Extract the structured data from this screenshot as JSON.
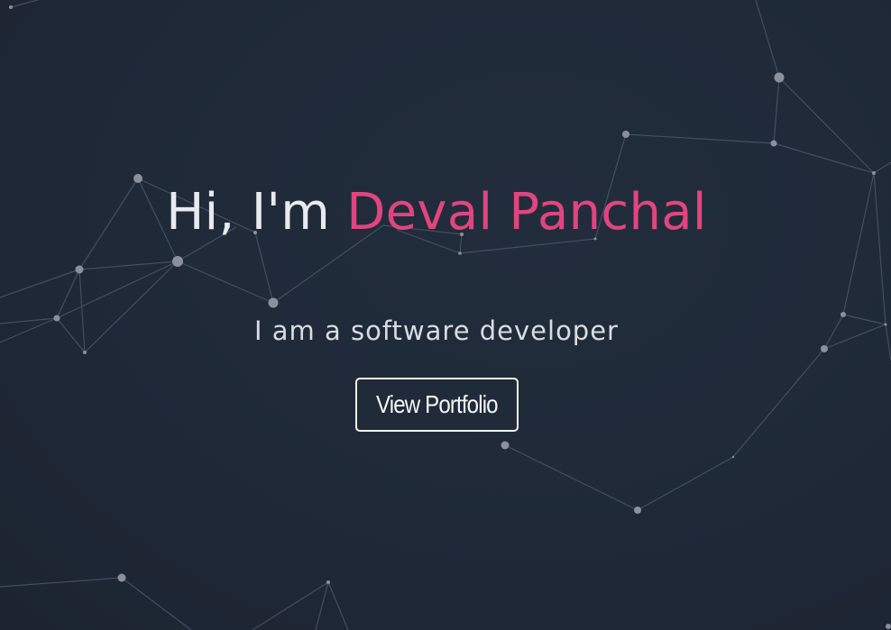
{
  "hero": {
    "greeting": "Hi, I'm",
    "name": "Deval Panchal",
    "subtitle": "I am a software developer",
    "cta_label": "View Portfolio"
  },
  "colors": {
    "background": "#202a38",
    "accent": "#e0457f",
    "text": "#e8eaee",
    "network_line": "#4a5566",
    "network_node": "#8a919c"
  }
}
